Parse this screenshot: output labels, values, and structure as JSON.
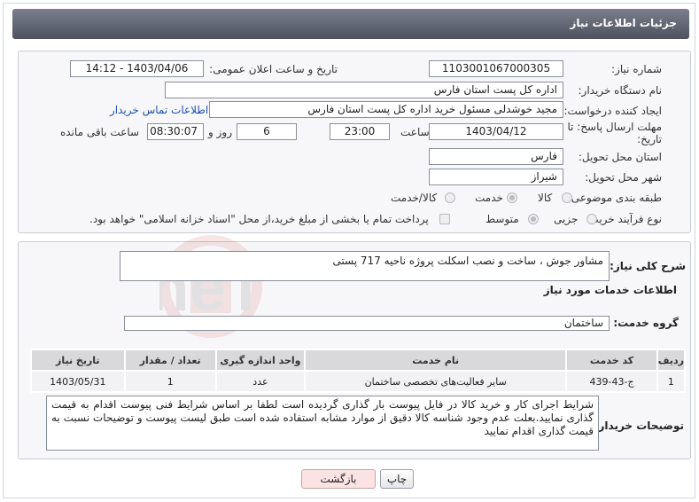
{
  "header": {
    "title": "جزئیات اطلاعات نیاز"
  },
  "form": {
    "need_number_label": "شماره نیاز:",
    "need_number": "1103001067000305",
    "announce_label": "تاریخ و ساعت اعلان عمومی:",
    "announce_value": "1403/04/06 - 14:12",
    "buyer_org_label": "نام دستگاه خریدار:",
    "buyer_org": "اداره کل پست استان فارس",
    "creator_label": "ایجاد کننده درخواست:",
    "creator": "مجید خوشدلی مسئول خرید اداره کل پست استان فارس",
    "contact_link": "اطلاعات تماس خریدار",
    "deadline_label": "مهلت ارسال پاسخ: تا تاریخ:",
    "deadline_date": "1403/04/12",
    "time_label": "ساعت",
    "deadline_time": "23:00",
    "days_value": "6",
    "days_label": "روز و",
    "remaining_time": "08:30:07",
    "remaining_label": "ساعت باقی مانده",
    "province_label": "استان محل تحویل:",
    "province": "فارس",
    "city_label": "شهر محل تحویل:",
    "city": "شیراز",
    "category_label": "طبقه بندی موضوعی:",
    "category_options": [
      "کالا",
      "خدمت",
      "کالا/خدمت"
    ],
    "category_selected": "خدمت",
    "process_label": "نوع فرآیند خرید :",
    "process_options": [
      "جزیی",
      "متوسط"
    ],
    "process_selected": "متوسط",
    "treasury_note": "پرداخت تمام یا بخشی از مبلغ خرید،از محل \"اسناد خزانه اسلامی\" خواهد بود."
  },
  "summary": {
    "label": "شرح کلی نیاز:",
    "value": "مشاور جوش ، ساخت و نصب اسکلت پروژه ناحیه 717 پستی",
    "services_title": "اطلاعات خدمات مورد نیاز",
    "group_label": "گروه خدمت:",
    "group_value": "ساختمان"
  },
  "table": {
    "headers": [
      "ردیف",
      "کد خدمت",
      "نام خدمت",
      "واحد اندازه گیری",
      "تعداد / مقدار",
      "تاریخ نیاز"
    ],
    "rows": [
      [
        "1",
        "ج-43-439",
        "سایر فعالیت‌های تخصصی ساختمان",
        "عدد",
        "1",
        "1403/05/31"
      ]
    ]
  },
  "buyer_notes": {
    "label": "توضیحات خریدار:",
    "text": "شرایط اجرای کار و خرید کالا در فایل پیوست بار گذاری گردیده است لطفا بر اساس شرایط فنی پیوست اقدام به قیمت گذاری نمایید.بعلت عدم وجود شناسه کالا دقیق از موارد مشابه استفاده شده است طبق لیست پیوست و توضیحات نسبت به قیمت گذاری اقدام نمایید"
  },
  "buttons": {
    "print": "چاپ",
    "back": "بازگشت"
  },
  "watermark": {
    "text": "AriaTender.neT"
  }
}
